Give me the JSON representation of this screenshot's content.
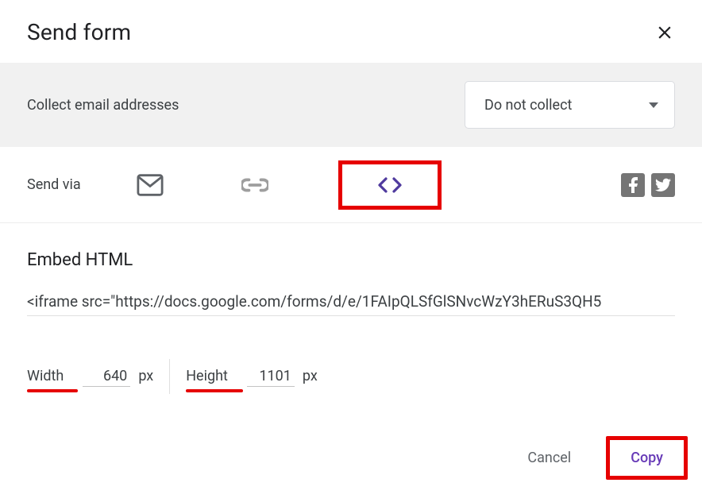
{
  "dialog": {
    "title": "Send form"
  },
  "collect": {
    "label": "Collect email addresses",
    "selected": "Do not collect"
  },
  "sendvia": {
    "label": "Send via"
  },
  "embed": {
    "title": "Embed HTML",
    "code": "<iframe src=\"https://docs.google.com/forms/d/e/1FAIpQLSfGlSNvcWzY3hERuS3QH5"
  },
  "dims": {
    "width_label": "Width",
    "width_value": "640",
    "width_unit": "px",
    "height_label": "Height",
    "height_value": "1101",
    "height_unit": "px"
  },
  "footer": {
    "cancel": "Cancel",
    "copy": "Copy"
  }
}
